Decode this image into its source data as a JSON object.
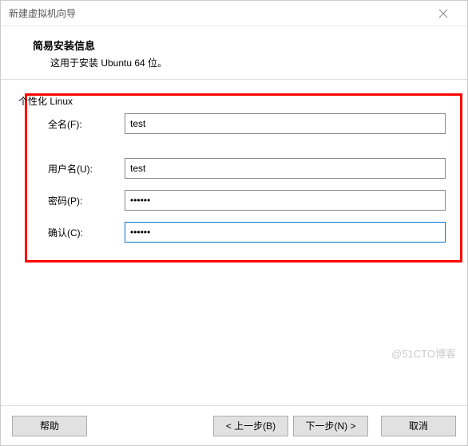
{
  "titlebar": {
    "title": "新建虚拟机向导"
  },
  "header": {
    "title": "简易安装信息",
    "subtitle": "这用于安装 Ubuntu 64 位。"
  },
  "section": {
    "label": "个性化 Linux"
  },
  "form": {
    "fullname": {
      "label": "全名(F):",
      "value": "test"
    },
    "username": {
      "label": "用户名(U):",
      "value": "test"
    },
    "password": {
      "label": "密码(P):",
      "value": "••••••"
    },
    "confirm": {
      "label": "确认(C):",
      "value": "••••••"
    }
  },
  "footer": {
    "help": "帮助",
    "back": "< 上一步(B)",
    "next": "下一步(N) >",
    "cancel": "取消"
  },
  "watermark": "@51CTO博客"
}
